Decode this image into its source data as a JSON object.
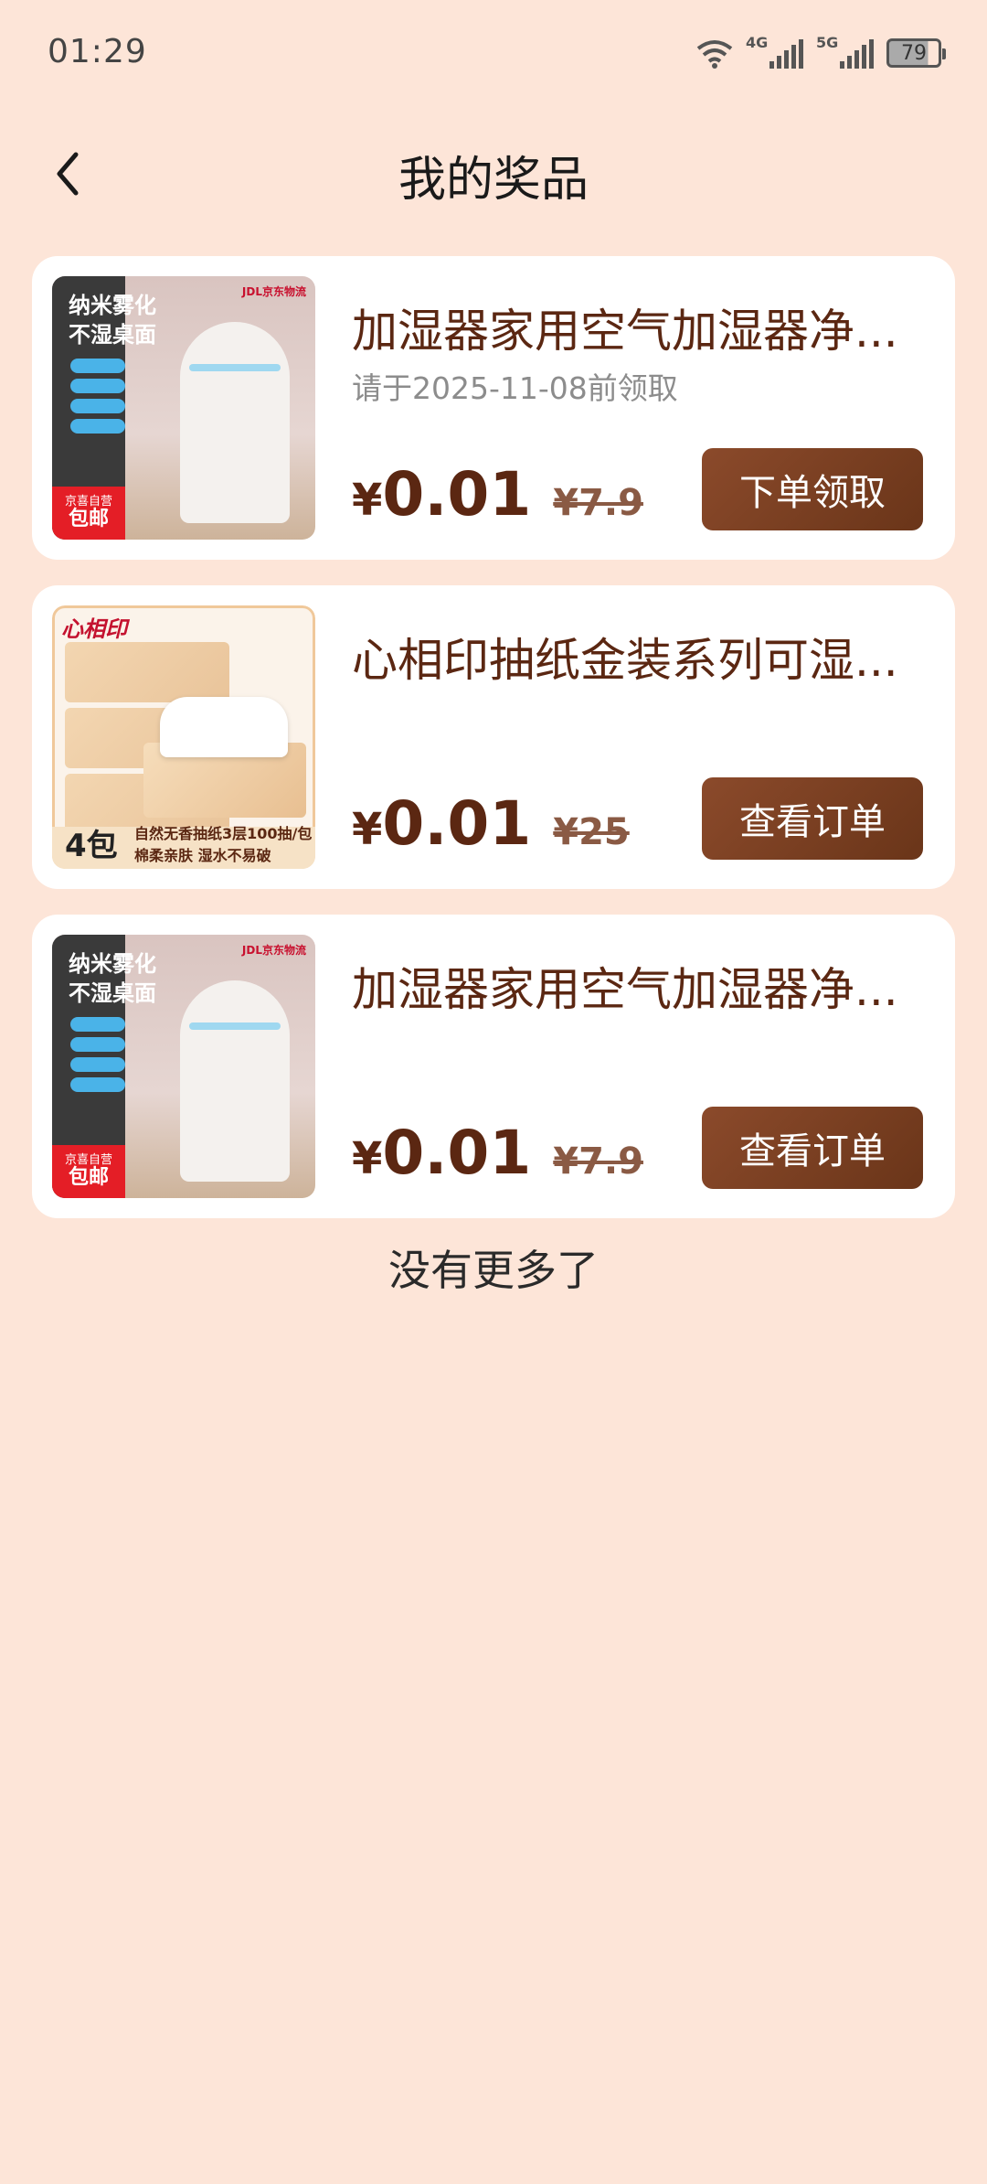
{
  "status_bar": {
    "time": "01:29",
    "network_1": "4G",
    "network_2": "5G",
    "battery": "79"
  },
  "header": {
    "title": "我的奖品"
  },
  "prizes": [
    {
      "name": "加湿器家用空气加湿器净...",
      "deadline": "请于2025-11-08前领取",
      "price_symbol": "¥",
      "price": "0.01",
      "original_price": "¥7.9",
      "action": "下单领取",
      "image": {
        "title_line1": "纳米雾化",
        "title_line2": "不湿桌面",
        "brand": "JDL京东物流",
        "badge_line1": "京喜自营",
        "badge_line2": "包邮"
      }
    },
    {
      "name": "心相印抽纸金装系列可湿...",
      "deadline": "",
      "price_symbol": "¥",
      "price": "0.01",
      "original_price": "¥25",
      "action": "查看订单",
      "image": {
        "logo": "心相印",
        "count": "4包",
        "caption_line1": "自然无香抽纸3层100抽/包",
        "caption_line2": "棉柔亲肤 湿水不易破"
      }
    },
    {
      "name": "加湿器家用空气加湿器净...",
      "deadline": "",
      "price_symbol": "¥",
      "price": "0.01",
      "original_price": "¥7.9",
      "action": "查看订单",
      "image": {
        "title_line1": "纳米雾化",
        "title_line2": "不湿桌面",
        "brand": "JDL京东物流",
        "badge_line1": "京喜自营",
        "badge_line2": "包邮"
      }
    }
  ],
  "footer": {
    "no_more": "没有更多了"
  },
  "colors": {
    "background": "#fde5d8",
    "accent": "#6a3519",
    "price": "#5b2712"
  }
}
